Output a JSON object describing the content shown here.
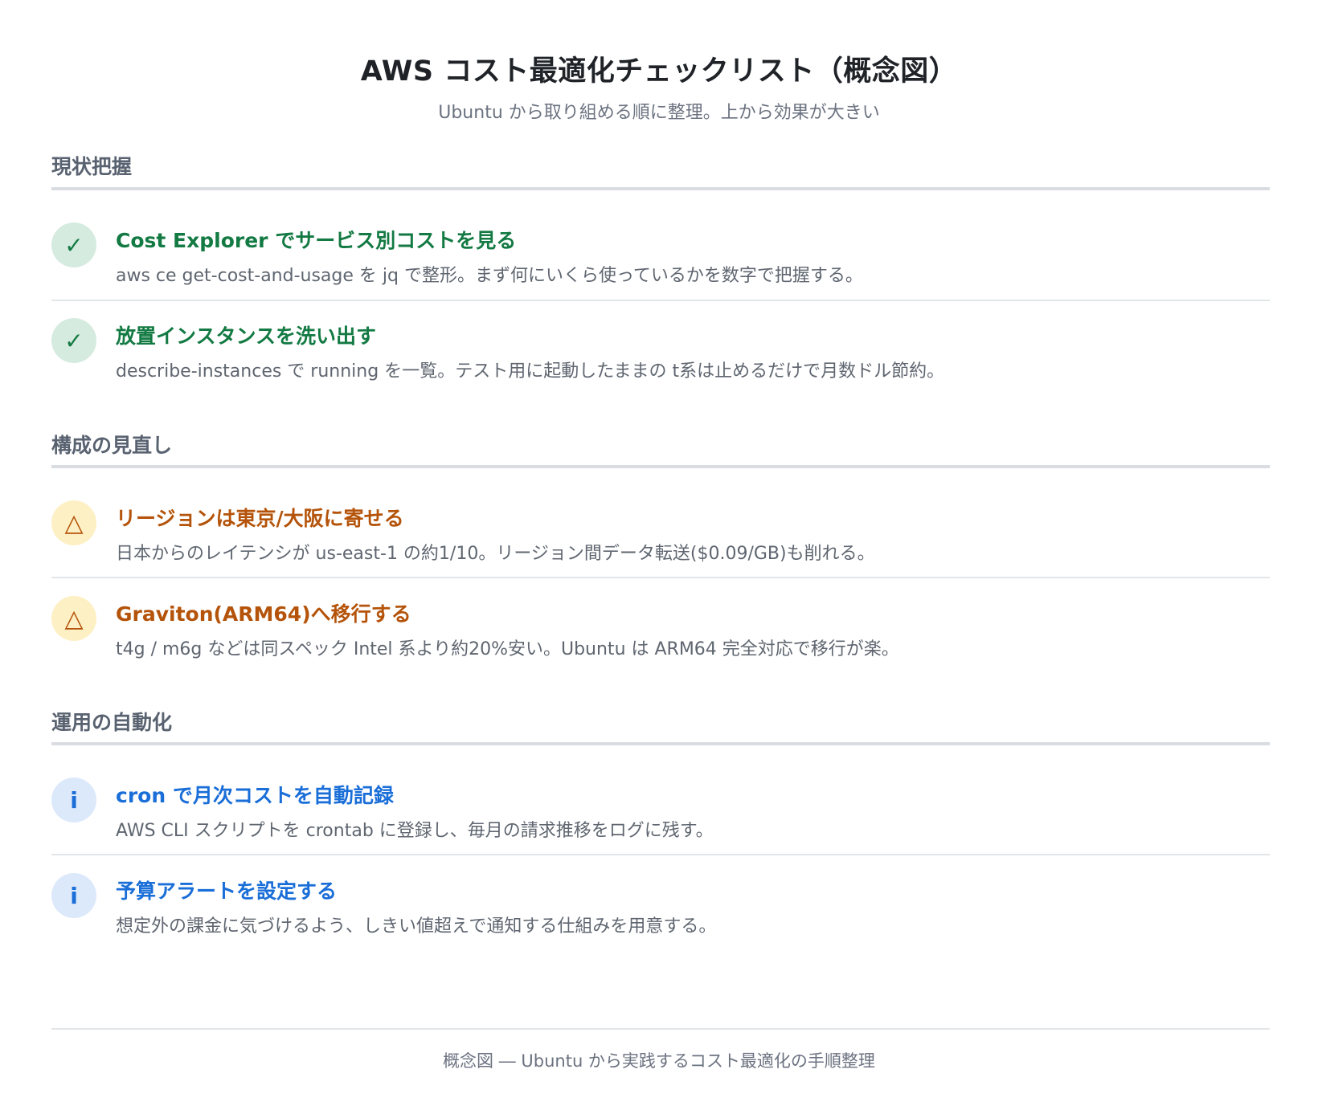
{
  "header": {
    "title": "AWS コスト最適化チェックリスト（概念図）",
    "subtitle": "Ubuntu から取り組める順に整理。上から効果が大きい"
  },
  "sections": [
    {
      "heading": "現状把握",
      "items": [
        {
          "status": "done",
          "icon": "check-icon",
          "glyph": "✓",
          "title": "Cost Explorer でサービス別コストを見る",
          "desc": "aws ce get-cost-and-usage を jq で整形。まず何にいくら使っているかを数字で把握する。"
        },
        {
          "status": "done",
          "icon": "check-icon",
          "glyph": "✓",
          "title": "放置インスタンスを洗い出す",
          "desc": "describe-instances で running を一覧。テスト用に起動したままの t系は止めるだけで月数ドル節約。"
        }
      ]
    },
    {
      "heading": "構成の見直し",
      "items": [
        {
          "status": "warning",
          "icon": "warning-triangle-icon",
          "glyph": "△",
          "title": "リージョンは東京/大阪に寄せる",
          "desc": "日本からのレイテンシが us-east-1 の約1/10。リージョン間データ転送($0.09/GB)も削れる。"
        },
        {
          "status": "warning",
          "icon": "warning-triangle-icon",
          "glyph": "△",
          "title": "Graviton(ARM64)へ移行する",
          "desc": "t4g / m6g などは同スペック Intel 系より約20%安い。Ubuntu は ARM64 完全対応で移行が楽。"
        }
      ]
    },
    {
      "heading": "運用の自動化",
      "items": [
        {
          "status": "info",
          "icon": "info-icon",
          "glyph": "i",
          "title": "cron で月次コストを自動記録",
          "desc": "AWS CLI スクリプトを crontab に登録し、毎月の請求推移をログに残す。"
        },
        {
          "status": "info",
          "icon": "info-icon",
          "glyph": "i",
          "title": "予算アラートを設定する",
          "desc": "想定外の課金に気づけるよう、しきい値超えで通知する仕組みを用意する。"
        }
      ]
    }
  ],
  "footer": {
    "caption": "概念図 ― Ubuntu から実践するコスト最適化の手順整理"
  },
  "colors": {
    "done": "#137a43",
    "warning": "#b45309",
    "info": "#1a6ed8"
  }
}
